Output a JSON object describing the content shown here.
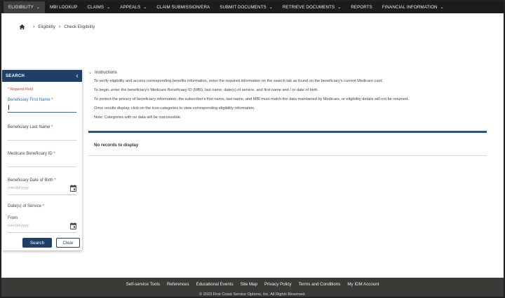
{
  "nav": {
    "items": [
      {
        "label": "ELIGIBILITY",
        "dropdown": true,
        "active": true
      },
      {
        "label": "MBI LOOKUP",
        "dropdown": false
      },
      {
        "label": "CLAIMS",
        "dropdown": true
      },
      {
        "label": "APPEALS",
        "dropdown": true
      },
      {
        "label": "CLAIM SUBMISSION/ERA",
        "dropdown": false
      },
      {
        "label": "SUBMIT DOCUMENTS",
        "dropdown": true
      },
      {
        "label": "RETRIEVE DOCUMENTS",
        "dropdown": true
      },
      {
        "label": "REPORTS",
        "dropdown": false
      },
      {
        "label": "FINANCIAL INFORMATION",
        "dropdown": true
      }
    ]
  },
  "breadcrumb": {
    "home_icon": "home-icon",
    "items": [
      "Eligibility",
      "Check Eligibility"
    ]
  },
  "sidebar": {
    "title": "SEARCH",
    "required_note": "* Required Field",
    "fields": {
      "first_name": {
        "label": "Beneficiary First Name",
        "value": ""
      },
      "last_name": {
        "label": "Beneficiary Last Name",
        "value": ""
      },
      "mbi": {
        "label": "Medicare Beneficiary ID",
        "value": ""
      },
      "dob": {
        "label": "Beneficiary Date of Birth",
        "placeholder": "mm/dd/yyyy"
      },
      "dos": {
        "label": "Date(s) of Service",
        "from_label": "From",
        "placeholder": "mm/dd/yyyy"
      }
    },
    "search_label": "Search",
    "clear_label": "Clear"
  },
  "instructions": {
    "heading": "Instructions",
    "lines": [
      "To verify eligibility and access corresponding benefits information, enter the required information on the search tab as found on the beneficiary's current Medicare card.",
      "To begin, enter the beneficiary's Medicare Beneficiary ID (MBI), last name, date(s) of service, and first name and / or date of birth.",
      "To protect the privacy of beneficiary information, the subscriber's first name, last name, and MBI must match the data maintained by Medicare, or eligibility details will not be returned.",
      "Once results display, click on the icon categories to view corresponding eligibility information.",
      "Note: Categories with no data will be inaccessible."
    ]
  },
  "results": {
    "message": "No records to display"
  },
  "footer": {
    "links": [
      "Self-service Tools",
      "References",
      "Educational Events",
      "Site Map",
      "Privacy Policy",
      "Terms and Conditions",
      "My IDM Account"
    ],
    "copyright": "© 2023 First Coast Service Options, Inc. All Rights Reserved."
  },
  "colors": {
    "nav_bg": "#1c1c1c",
    "accent": "#1e3f66",
    "results_bar": "#1e5a85",
    "footer_bg": "#3a3a36"
  }
}
